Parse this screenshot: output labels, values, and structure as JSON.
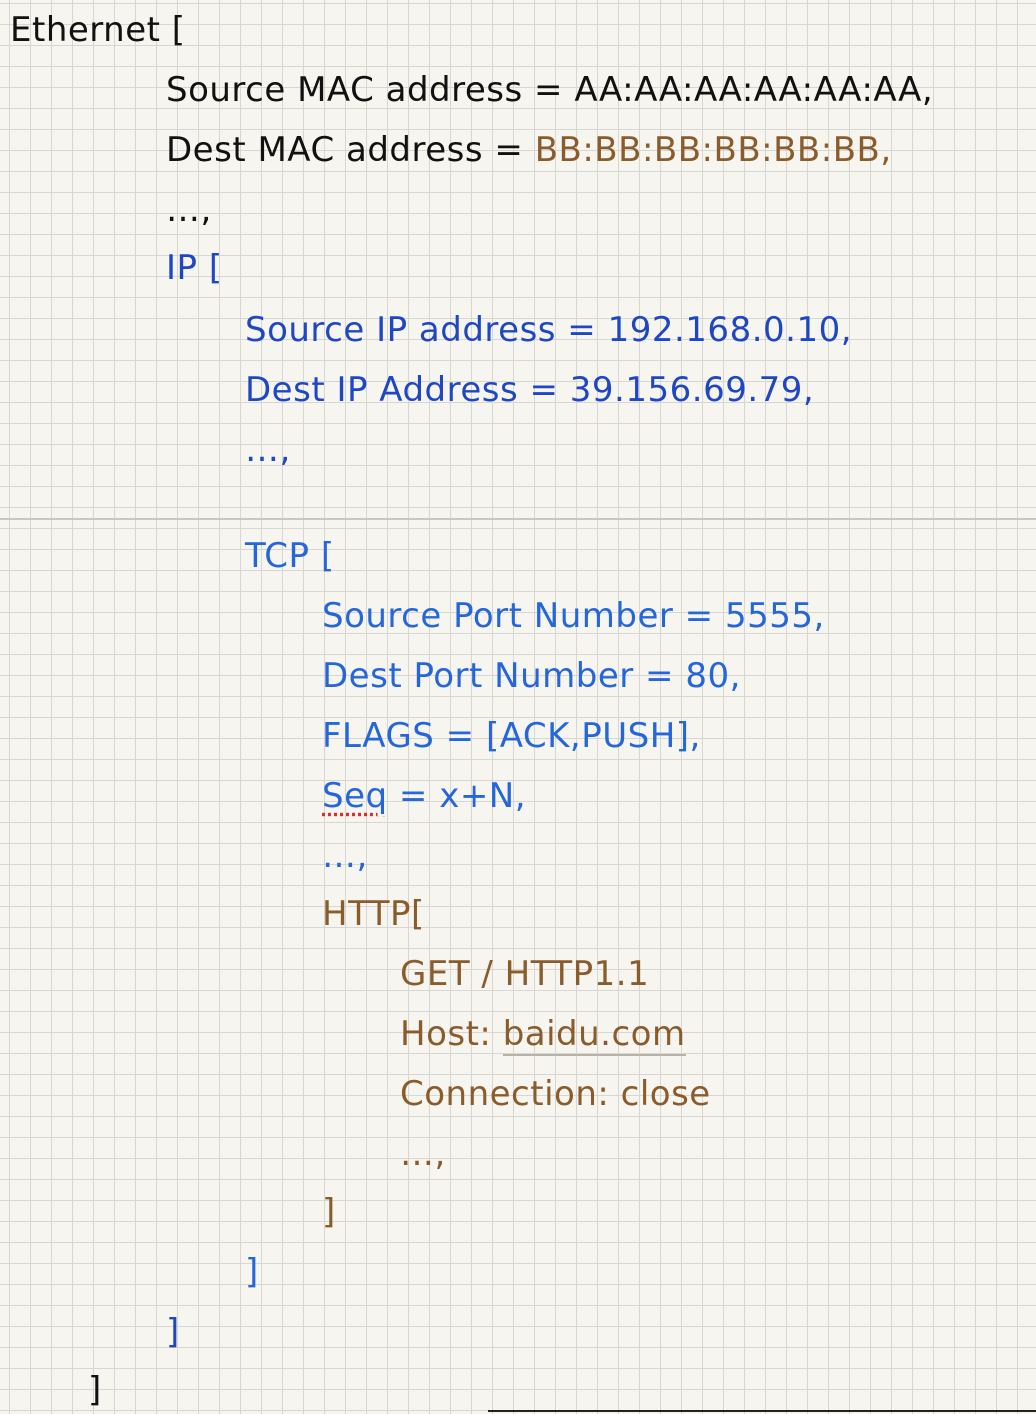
{
  "ethernet": {
    "open": "Ethernet [",
    "src_mac_label": "Source MAC address = ",
    "src_mac_value": "AA:AA:AA:AA:AA:AA,",
    "dst_mac_label": "Dest MAC address = ",
    "dst_mac_value": "BB:BB:BB:BB:BB:BB,",
    "ellipsis": "…,",
    "close": "]"
  },
  "ip": {
    "open": "IP [",
    "src": "Source IP address = 192.168.0.10,",
    "dst": "Dest IP Address = 39.156.69.79,",
    "ellipsis": "…,",
    "close": "]"
  },
  "tcp": {
    "open": "TCP [",
    "src_port": "Source Port Number = 5555,",
    "dst_port": "Dest Port Number = 80,",
    "flags": "FLAGS = [ACK,PUSH],",
    "seq_word": "Seq",
    "seq_rest": " = x+N,",
    "ellipsis": "…,",
    "close": "]"
  },
  "http": {
    "open": "HTTP[",
    "request_line": "GET / HTTP1.1",
    "host_label": "Host: ",
    "host_value": "baidu.com",
    "connection": "Connection: close",
    "ellipsis": "…,",
    "close": "]"
  },
  "colors": {
    "ethernet": "#111111",
    "mac_highlight": "#8a5c2c",
    "ip": "#1f47c4",
    "tcp": "#2566db",
    "http": "#8a5c2c"
  }
}
